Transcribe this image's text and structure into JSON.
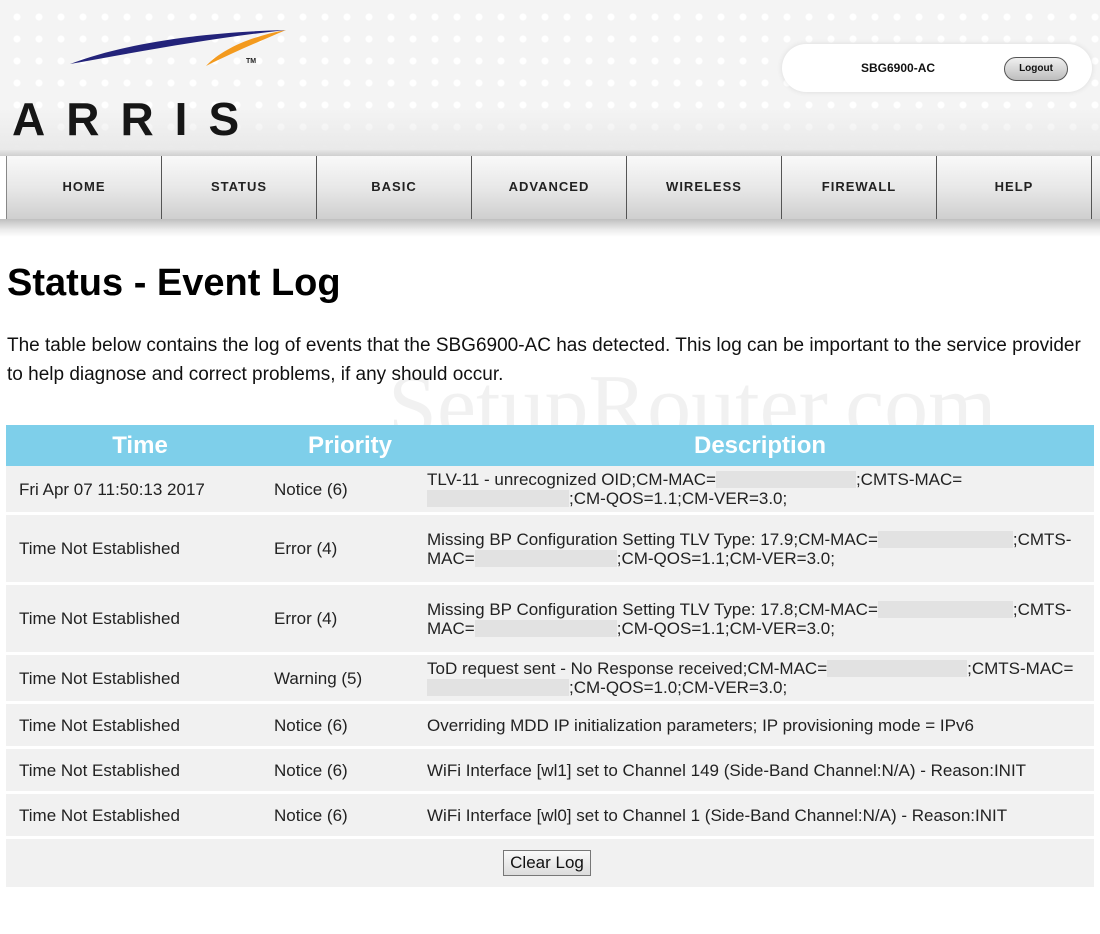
{
  "header": {
    "logo_text": "ARRIS",
    "logo_tm": "TM",
    "model": "SBG6900-AC",
    "logout_label": "Logout"
  },
  "nav": {
    "items": [
      {
        "label": "HOME"
      },
      {
        "label": "STATUS"
      },
      {
        "label": "BASIC"
      },
      {
        "label": "ADVANCED"
      },
      {
        "label": "WIRELESS"
      },
      {
        "label": "FIREWALL"
      },
      {
        "label": "HELP"
      }
    ]
  },
  "page": {
    "title": "Status - Event Log",
    "intro": "The table below contains the log of events that the SBG6900-AC has detected. This log can be important to the service provider to help diagnose and correct problems, if any should occur.",
    "watermark": "SetupRouter.com"
  },
  "table": {
    "headers": {
      "time": "Time",
      "priority": "Priority",
      "description": "Description"
    },
    "rows": [
      {
        "time": "Fri Apr 07 11:50:13 2017",
        "priority": "Notice (6)",
        "desc_parts": [
          "TLV-11 - unrecognized OID;CM-MAC=",
          ";CMTS-MAC=",
          ";CM-QOS=1.1;CM-VER=3.0;"
        ]
      },
      {
        "time": "Time Not Established",
        "priority": "Error (4)",
        "desc_parts": [
          "Missing BP Configuration Setting TLV Type: 17.9;CM-MAC=",
          ";CMTS-MAC=",
          ";CM-QOS=1.1;CM-VER=3.0;"
        ]
      },
      {
        "time": "Time Not Established",
        "priority": "Error (4)",
        "desc_parts": [
          "Missing BP Configuration Setting TLV Type: 17.8;CM-MAC=",
          ";CMTS-MAC=",
          ";CM-QOS=1.1;CM-VER=3.0;"
        ]
      },
      {
        "time": "Time Not Established",
        "priority": "Warning (5)",
        "desc_parts": [
          "ToD request sent - No Response received;CM-MAC=",
          ";CMTS-MAC=",
          ";CM-QOS=1.0;CM-VER=3.0;"
        ]
      },
      {
        "time": "Time Not Established",
        "priority": "Notice (6)",
        "description": "Overriding MDD IP initialization parameters; IP provisioning mode = IPv6"
      },
      {
        "time": "Time Not Established",
        "priority": "Notice (6)",
        "description": "WiFi Interface [wl1] set to Channel 149 (Side-Band Channel:N/A) - Reason:INIT"
      },
      {
        "time": "Time Not Established",
        "priority": "Notice (6)",
        "description": "WiFi Interface [wl0] set to Channel 1 (Side-Band Channel:N/A) - Reason:INIT"
      }
    ],
    "clear_label": "Clear Log"
  }
}
